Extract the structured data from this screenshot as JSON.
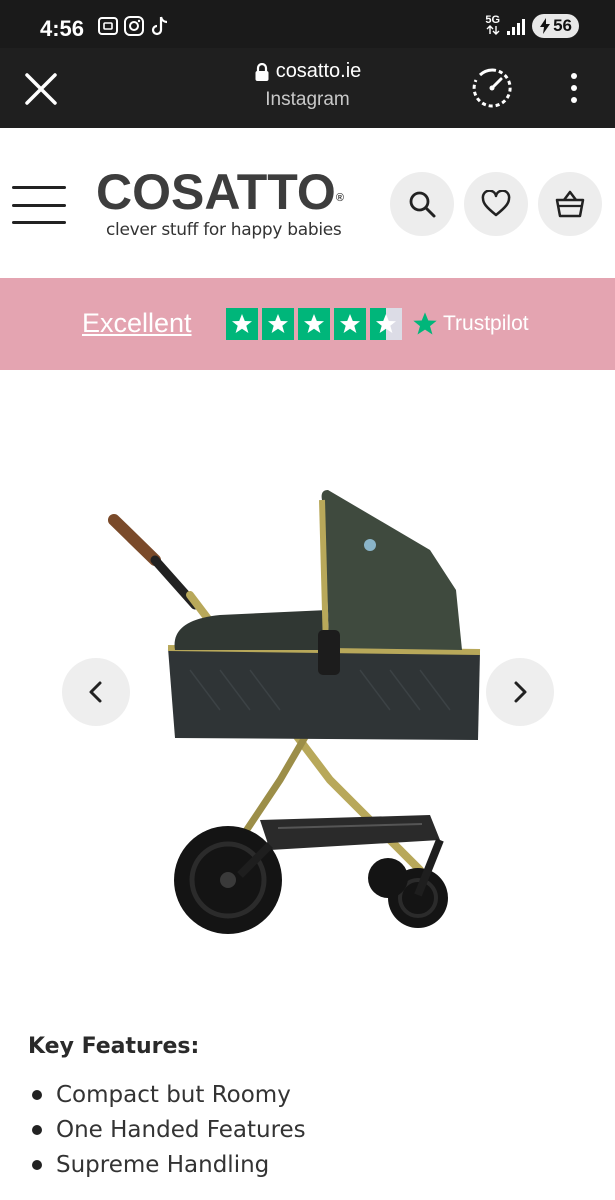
{
  "status_bar": {
    "time": "4:56",
    "network": "5G",
    "battery": "56"
  },
  "browser": {
    "url": "cosatto.ie",
    "source": "Instagram"
  },
  "header": {
    "logo_text": "COSATTO",
    "logo_reg": "®",
    "tagline": "clever stuff for happy babies"
  },
  "trust": {
    "rating_label": "Excellent",
    "brand": "Trustpilot",
    "stars": 4.5,
    "colors": {
      "banner": "#e4a4b1",
      "star": "#00b67a"
    }
  },
  "features": {
    "title": "Key Features:",
    "items": [
      "Compact but Roomy",
      "One Handed Features",
      "Supreme Handling"
    ]
  }
}
